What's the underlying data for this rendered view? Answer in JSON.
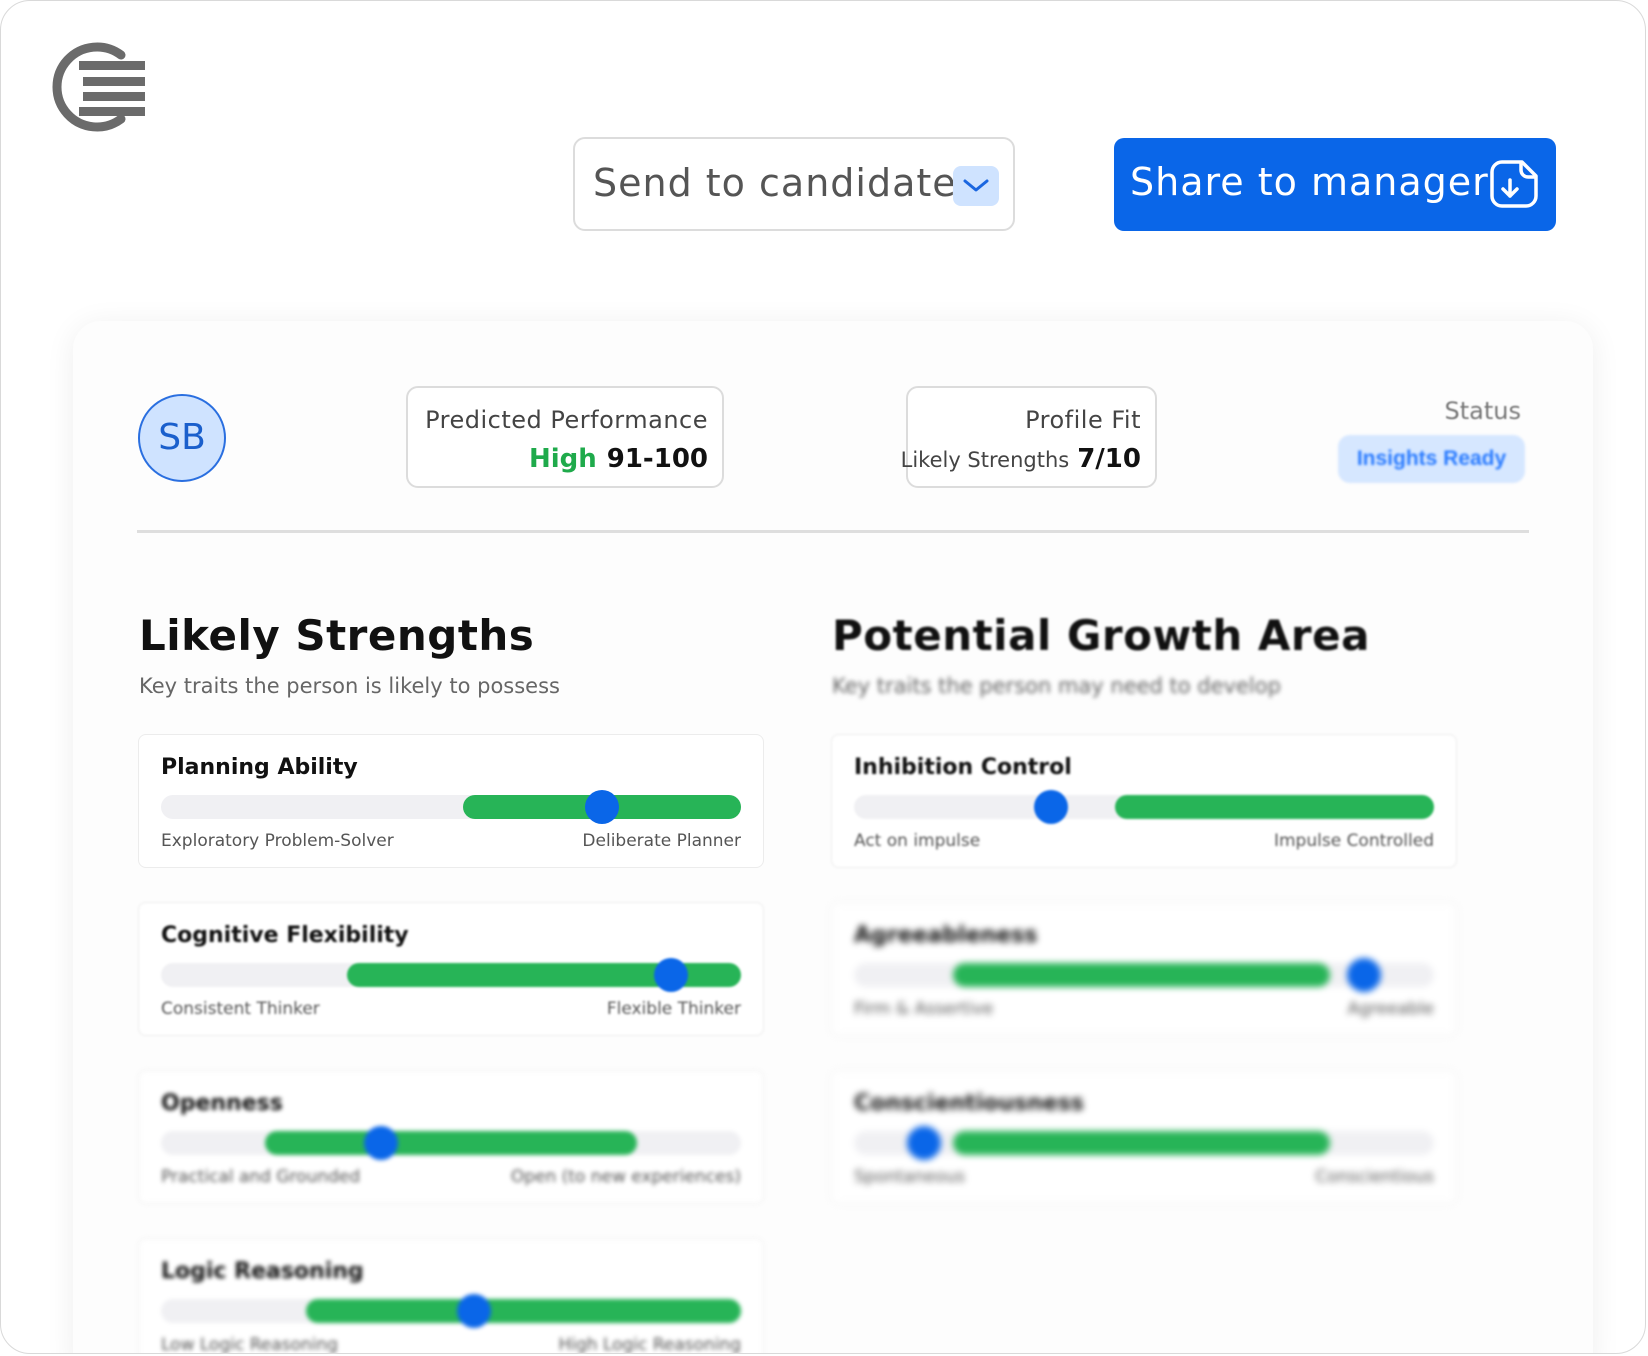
{
  "actions": {
    "send_label": "Send to candidate",
    "share_label": "Share to manager"
  },
  "candidate": {
    "initials": "SB"
  },
  "summary": {
    "predicted_title": "Predicted Performance",
    "predicted_level": "High",
    "predicted_range": "91-100",
    "profile_title": "Profile Fit",
    "profile_label": "Likely Strengths",
    "profile_value": "7/10",
    "status_label": "Status",
    "status_value": "Insights Ready"
  },
  "strengths": {
    "title": "Likely Strengths",
    "subtitle": "Key traits the person is likely to possess",
    "traits": [
      {
        "name": "Planning Ability",
        "low": "Exploratory Problem-Solver",
        "high": "Deliberate Planner",
        "range": [
          0.52,
          1.0
        ],
        "value": 0.76
      },
      {
        "name": "Cognitive Flexibility",
        "low": "Consistent Thinker",
        "high": "Flexible Thinker",
        "range": [
          0.32,
          1.0
        ],
        "value": 0.88
      },
      {
        "name": "Openness",
        "low": "Practical and Grounded",
        "high": "Open (to new experiences)",
        "range": [
          0.18,
          0.82
        ],
        "value": 0.38
      },
      {
        "name": "Logic Reasoning",
        "low": "Low Logic Reasoning",
        "high": "High Logic Reasoning",
        "range": [
          0.25,
          1.0
        ],
        "value": 0.54
      }
    ]
  },
  "growth": {
    "title": "Potential Growth Area",
    "subtitle": "Key traits the person may need to develop",
    "traits": [
      {
        "name": "Inhibition Control",
        "low": "Act on impulse",
        "high": "Impulse Controlled",
        "range": [
          0.45,
          1.0
        ],
        "value": 0.34
      },
      {
        "name": "Agreeableness",
        "low": "Firm & Assertive",
        "high": "Agreeable",
        "range": [
          0.17,
          0.82
        ],
        "value": 0.88
      },
      {
        "name": "Conscientiousness",
        "low": "Spontaneous",
        "high": "Conscientious",
        "range": [
          0.17,
          0.82
        ],
        "value": 0.12
      }
    ]
  },
  "colors": {
    "accent": "#0a66e8",
    "bar_fill": "#27b457",
    "level_high": "#1faa4b"
  }
}
